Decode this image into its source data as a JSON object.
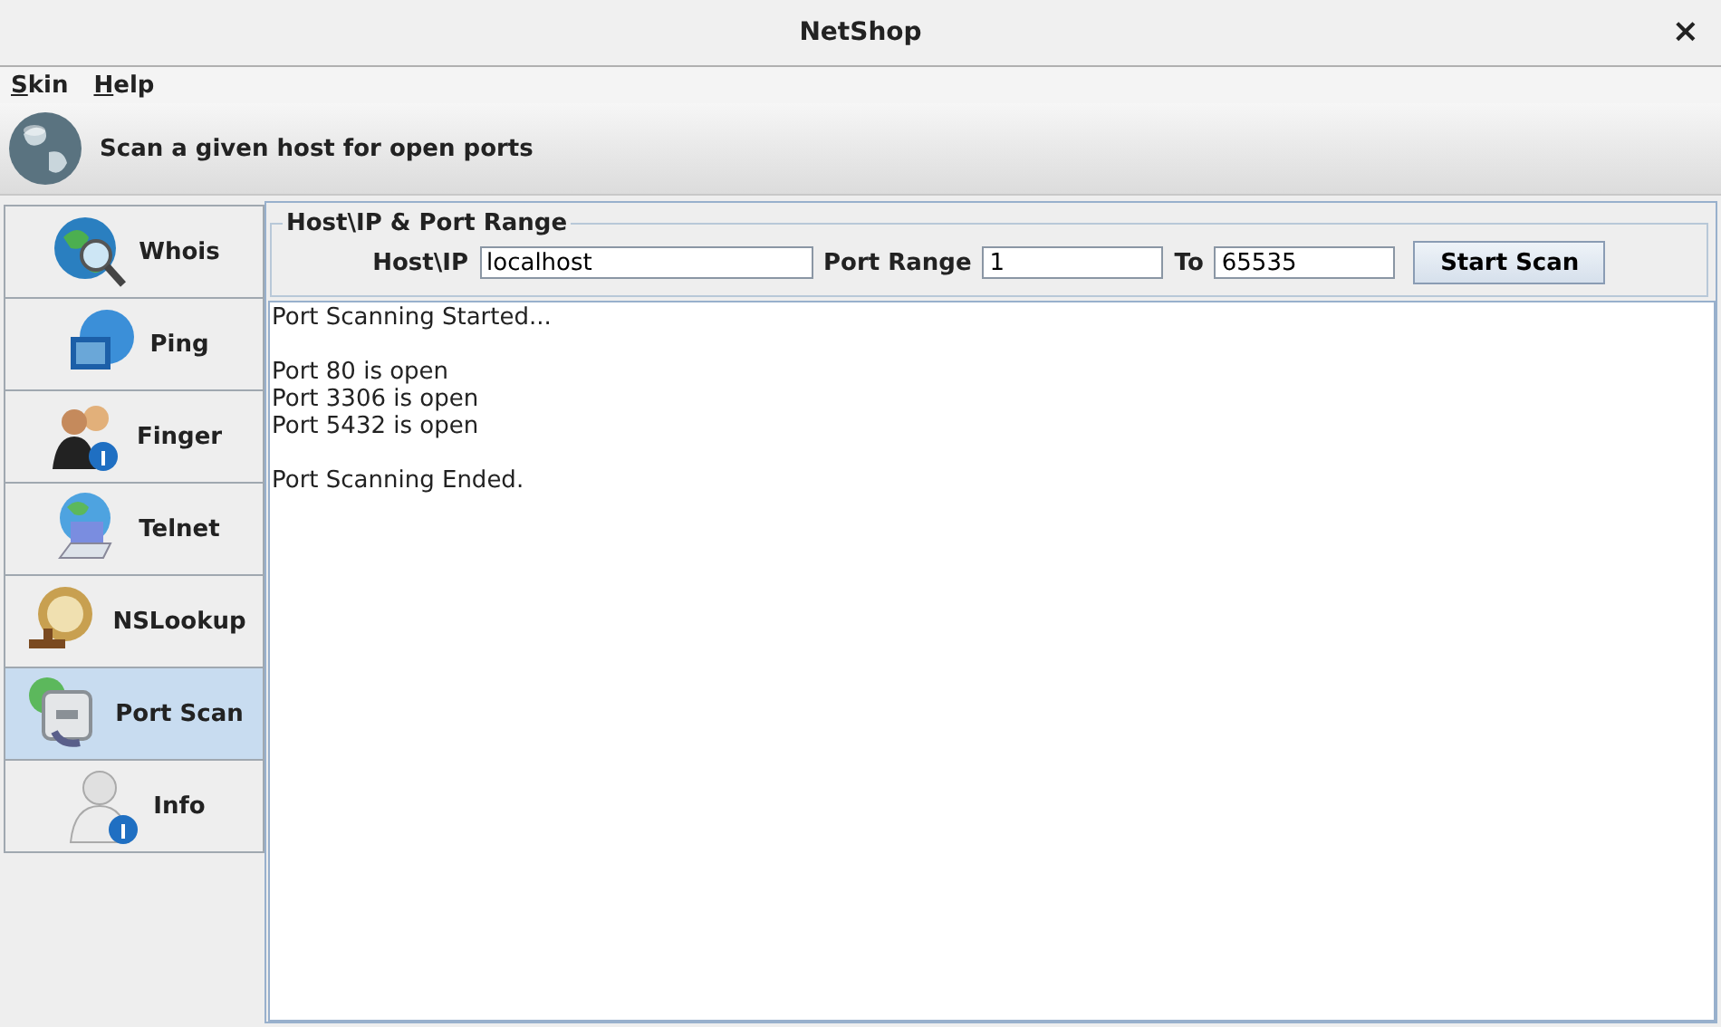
{
  "window": {
    "title": "NetShop",
    "close": "×"
  },
  "menu": [
    "Skin",
    "Help"
  ],
  "header": {
    "text": "Scan a given host for open ports"
  },
  "tabs": [
    {
      "label": "Whois",
      "selected": false
    },
    {
      "label": "Ping",
      "selected": false
    },
    {
      "label": "Finger",
      "selected": false
    },
    {
      "label": "Telnet",
      "selected": false
    },
    {
      "label": "NSLookup",
      "selected": false
    },
    {
      "label": "Port Scan",
      "selected": true
    },
    {
      "label": "Info",
      "selected": false
    }
  ],
  "range_group": {
    "title": "Host\\IP & Port Range",
    "host_label": "Host\\IP",
    "host": "localhost",
    "range_label": "Port Range",
    "from": "1",
    "to_label": "To",
    "to": "65535",
    "button": "Start Scan"
  },
  "output": [
    [
      "Port Scanning Started..."
    ],
    [
      "Port 80 is open",
      "Port 3306 is open",
      "Port 5432 is open"
    ],
    [
      "Port Scanning Ended."
    ]
  ]
}
